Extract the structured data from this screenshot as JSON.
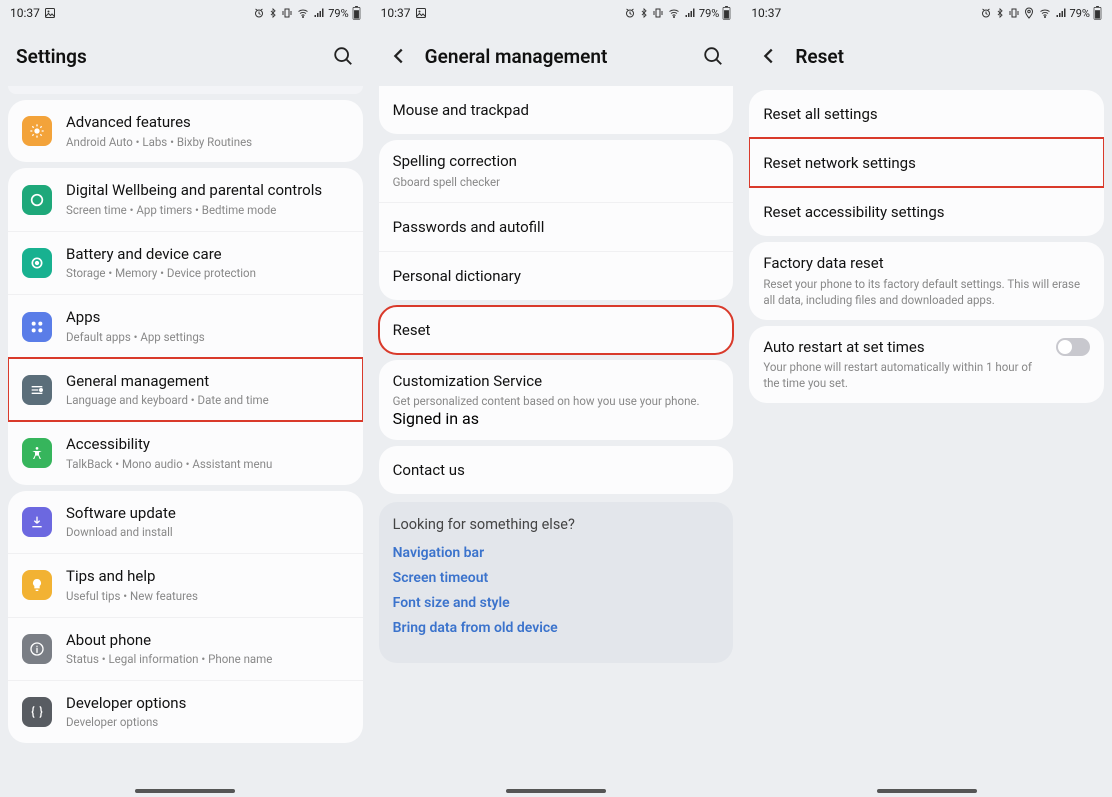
{
  "status": {
    "time": "10:37",
    "battery": "79%"
  },
  "screen1": {
    "title": "Settings",
    "items": [
      {
        "label": "Advanced features",
        "sub": "Android Auto  •  Labs  •  Bixby Routines"
      },
      {
        "label": "Digital Wellbeing and parental controls",
        "sub": "Screen time  •  App timers  •  Bedtime mode"
      },
      {
        "label": "Battery and device care",
        "sub": "Storage  •  Memory  •  Device protection"
      },
      {
        "label": "Apps",
        "sub": "Default apps  •  App settings"
      },
      {
        "label": "General management",
        "sub": "Language and keyboard  •  Date and time"
      },
      {
        "label": "Accessibility",
        "sub": "TalkBack  •  Mono audio  •  Assistant menu"
      },
      {
        "label": "Software update",
        "sub": "Download and install"
      },
      {
        "label": "Tips and help",
        "sub": "Useful tips  •  New features"
      },
      {
        "label": "About phone",
        "sub": "Status  •  Legal information  •  Phone name"
      },
      {
        "label": "Developer options",
        "sub": "Developer options"
      }
    ]
  },
  "screen2": {
    "title": "General management",
    "groups": {
      "g1": [
        {
          "label": "Mouse and trackpad"
        }
      ],
      "g2": [
        {
          "label": "Spelling correction",
          "sub": "Gboard spell checker"
        },
        {
          "label": "Passwords and autofill"
        },
        {
          "label": "Personal dictionary"
        }
      ],
      "g3": [
        {
          "label": "Reset"
        }
      ],
      "g4": [
        {
          "label": "Customization Service",
          "sub": "Get personalized content based on how you use your phone.",
          "link": "Signed in as"
        }
      ],
      "g5": [
        {
          "label": "Contact us"
        }
      ]
    },
    "footer": {
      "heading": "Looking for something else?",
      "links": [
        "Navigation bar",
        "Screen timeout",
        "Font size and style",
        "Bring data from old device"
      ]
    }
  },
  "screen3": {
    "title": "Reset",
    "g1": [
      {
        "label": "Reset all settings"
      },
      {
        "label": "Reset network settings"
      },
      {
        "label": "Reset accessibility settings"
      }
    ],
    "g2": [
      {
        "label": "Factory data reset",
        "sub": "Reset your phone to its factory default settings. This will erase all data, including files and downloaded apps."
      }
    ],
    "g3": [
      {
        "label": "Auto restart at set times",
        "sub": "Your phone will restart automatically within 1 hour of the time you set."
      }
    ]
  }
}
